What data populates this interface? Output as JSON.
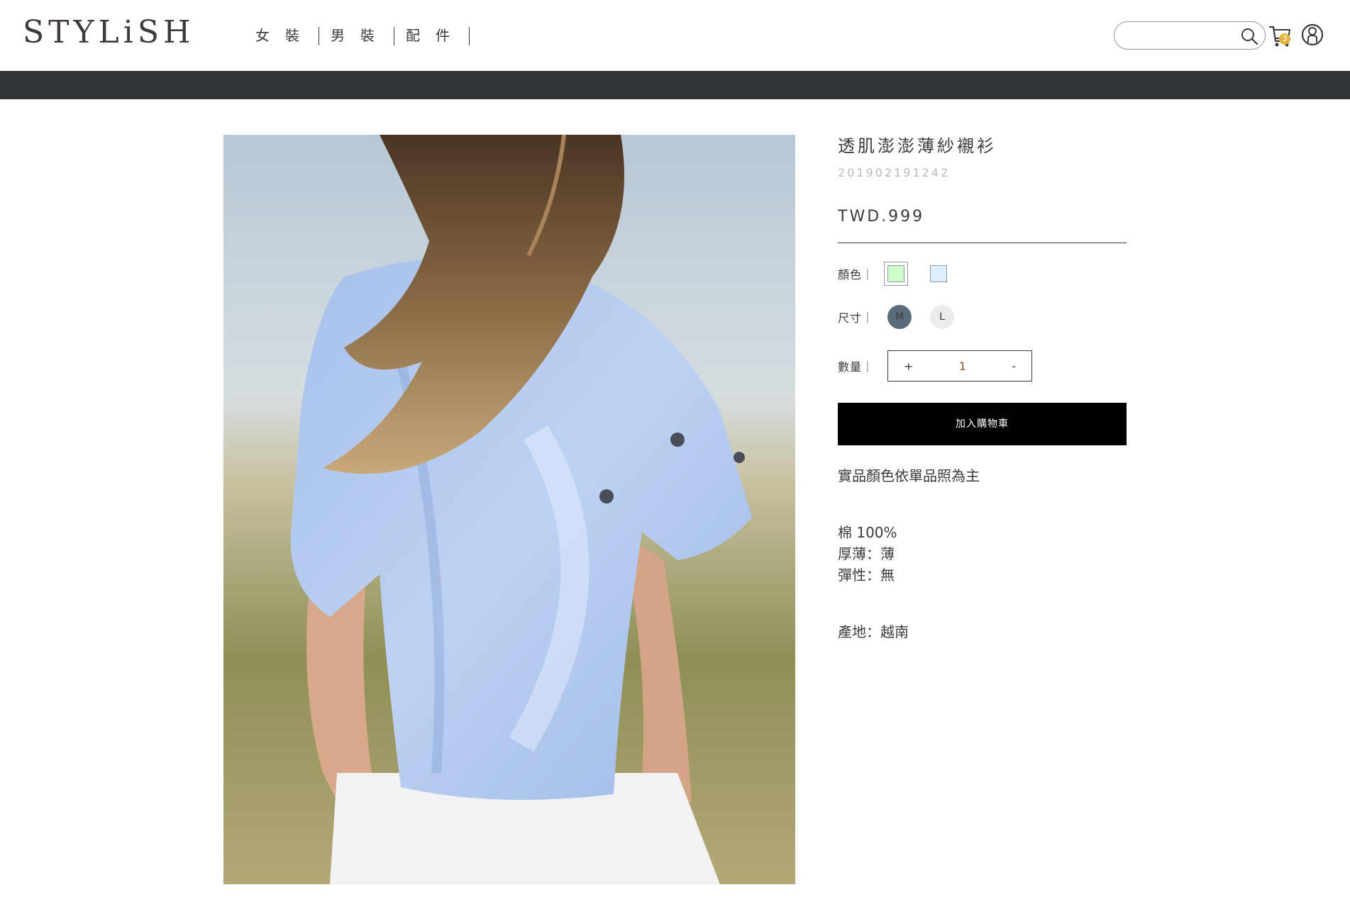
{
  "header": {
    "logo": "STYLiSH",
    "nav": [
      "女裝",
      "男裝",
      "配件"
    ],
    "search": {
      "value": "",
      "placeholder": ""
    },
    "cart_count": "3"
  },
  "product": {
    "title": "透肌澎澎薄紗襯衫",
    "id": "201902191242",
    "price": "TWD.999",
    "color_label": "顏色｜",
    "colors": [
      "#CCFFCC",
      "#DDF0FF"
    ],
    "size_label": "尺寸｜",
    "sizes": [
      "M",
      "L"
    ],
    "quantity_label": "數量｜",
    "quantity": {
      "minus": "+",
      "value": "1",
      "plus": "-"
    },
    "add_to_cart": "加入購物車",
    "note": "實品顏色依單品照為主",
    "texture": "棉 100%",
    "thickness": "厚薄：薄",
    "elasticity": "彈性：無",
    "place": "產地：越南"
  },
  "colors": {
    "dark_bar": "#313538",
    "text": "#3f3a3a",
    "badge": "#e2b33a"
  }
}
